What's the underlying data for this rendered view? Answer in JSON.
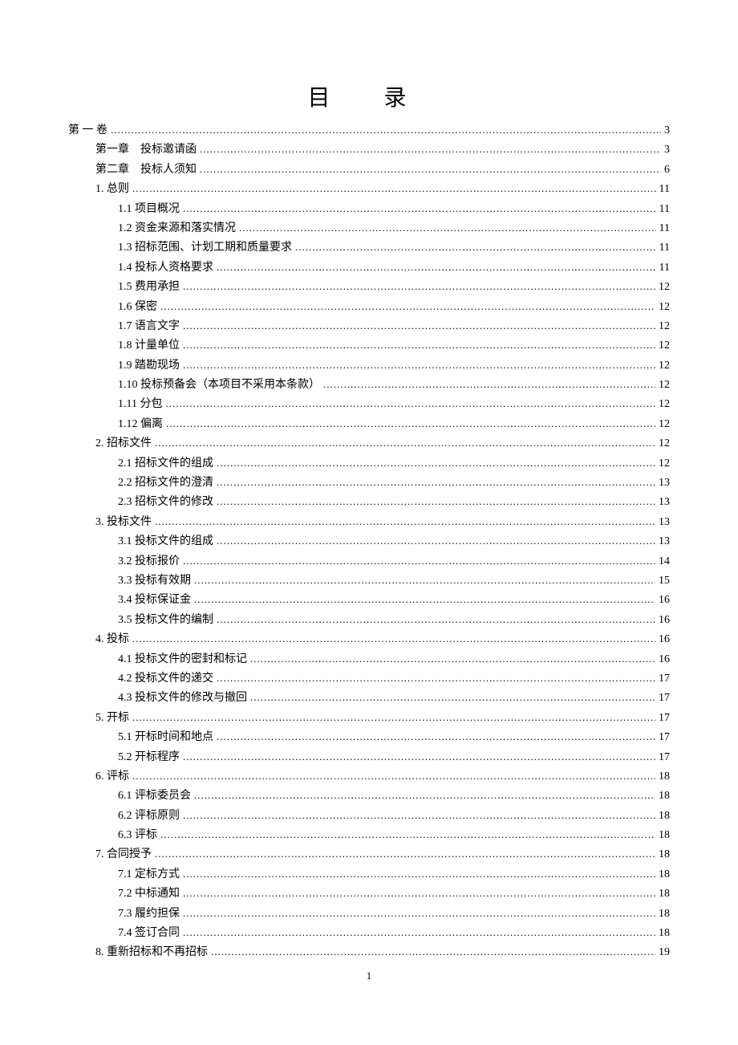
{
  "title": "目 录",
  "pageNumber": "1",
  "toc": [
    {
      "indent": 0,
      "label": "第 一 卷",
      "page": "3"
    },
    {
      "indent": 1,
      "label": "第一章　投标邀请函",
      "page": "3"
    },
    {
      "indent": 1,
      "label": "第二章　投标人须知",
      "page": "6"
    },
    {
      "indent": 2,
      "label": "1.  总则",
      "page": "11"
    },
    {
      "indent": 3,
      "label": "1.1  项目概况",
      "page": "11"
    },
    {
      "indent": 3,
      "label": "1.2  资金来源和落实情况",
      "page": "11"
    },
    {
      "indent": 3,
      "label": "1.3  招标范围、计划工期和质量要求",
      "page": "11"
    },
    {
      "indent": 3,
      "label": "1.4  投标人资格要求",
      "page": "11"
    },
    {
      "indent": 3,
      "label": "1.5  费用承担",
      "page": "12"
    },
    {
      "indent": 3,
      "label": "1.6  保密",
      "page": "12"
    },
    {
      "indent": 3,
      "label": "1.7  语言文字",
      "page": "12"
    },
    {
      "indent": 3,
      "label": "1.8  计量单位",
      "page": "12"
    },
    {
      "indent": 3,
      "label": "1.9  踏勘现场",
      "page": "12"
    },
    {
      "indent": 3,
      "label": "1.10  投标预备会（本项目不采用本条款）",
      "page": "12"
    },
    {
      "indent": 3,
      "label": "1.11  分包",
      "page": "12"
    },
    {
      "indent": 3,
      "label": "1.12  偏离",
      "page": "12"
    },
    {
      "indent": 2,
      "label": "2.  招标文件",
      "page": "12"
    },
    {
      "indent": 3,
      "label": "2.1  招标文件的组成",
      "page": "12"
    },
    {
      "indent": 3,
      "label": "2.2  招标文件的澄清",
      "page": "13"
    },
    {
      "indent": 3,
      "label": "2.3  招标文件的修改",
      "page": "13"
    },
    {
      "indent": 2,
      "label": "3.  投标文件",
      "page": "13"
    },
    {
      "indent": 3,
      "label": "3.1  投标文件的组成",
      "page": "13"
    },
    {
      "indent": 3,
      "label": "3.2  投标报价",
      "page": "14"
    },
    {
      "indent": 3,
      "label": "3.3  投标有效期",
      "page": "15"
    },
    {
      "indent": 3,
      "label": "3.4  投标保证金",
      "page": "16"
    },
    {
      "indent": 3,
      "label": "3.5  投标文件的编制",
      "page": "16"
    },
    {
      "indent": 2,
      "label": "4.  投标",
      "page": "16"
    },
    {
      "indent": 3,
      "label": "4.1  投标文件的密封和标记",
      "page": "16"
    },
    {
      "indent": 3,
      "label": "4.2  投标文件的递交",
      "page": "17"
    },
    {
      "indent": 3,
      "label": "4.3  投标文件的修改与撤回",
      "page": "17"
    },
    {
      "indent": 2,
      "label": "5.  开标",
      "page": "17"
    },
    {
      "indent": 3,
      "label": "5.1  开标时间和地点",
      "page": "17"
    },
    {
      "indent": 3,
      "label": "5.2  开标程序",
      "page": "17"
    },
    {
      "indent": 2,
      "label": "6.  评标",
      "page": "18"
    },
    {
      "indent": 3,
      "label": "6.1  评标委员会",
      "page": "18"
    },
    {
      "indent": 3,
      "label": "6.2  评标原则",
      "page": "18"
    },
    {
      "indent": 3,
      "label": "6.3  评标",
      "page": "18"
    },
    {
      "indent": 2,
      "label": "7.  合同授予",
      "page": "18"
    },
    {
      "indent": 3,
      "label": "7.1  定标方式",
      "page": "18"
    },
    {
      "indent": 3,
      "label": "7.2  中标通知",
      "page": "18"
    },
    {
      "indent": 3,
      "label": "7.3  履约担保",
      "page": "18"
    },
    {
      "indent": 3,
      "label": "7.4  签订合同",
      "page": "18"
    },
    {
      "indent": 2,
      "label": "8.  重新招标和不再招标",
      "page": "19"
    }
  ]
}
